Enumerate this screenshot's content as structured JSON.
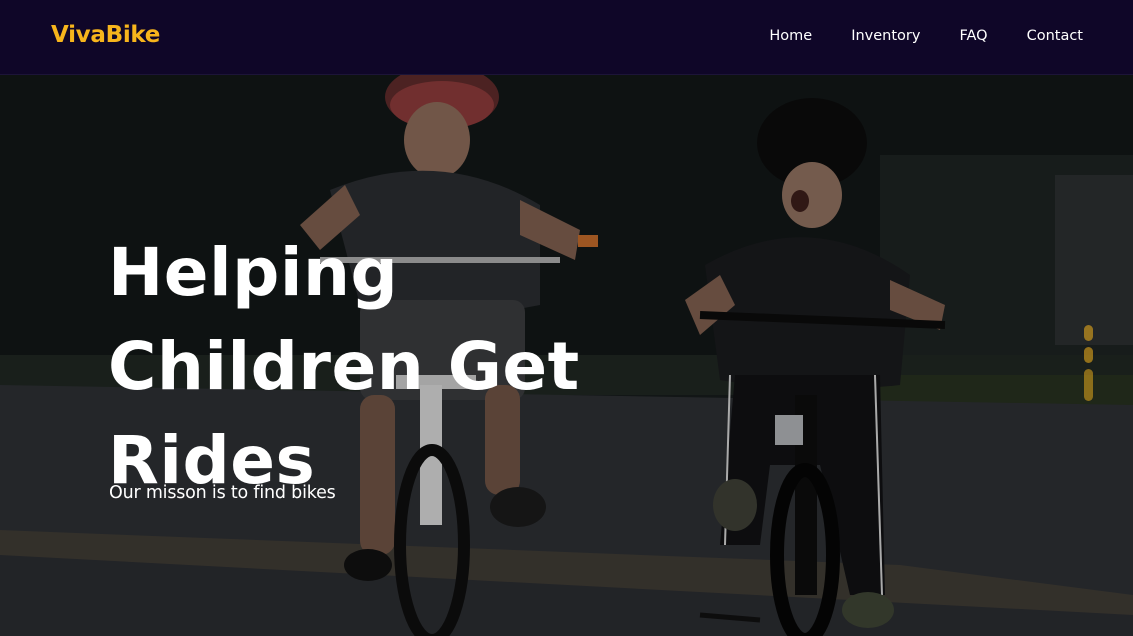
{
  "navbar": {
    "brand": "VivaBike",
    "links": [
      "Home",
      "Inventory",
      "FAQ",
      "Contact"
    ]
  },
  "hero": {
    "title_lines": [
      "Helping",
      "Children Get",
      "Rides"
    ],
    "subtitle": "Our misson is to find bikes",
    "slide_count": 3,
    "active_slide": 3
  },
  "colors": {
    "brand": "#f7b51c",
    "nav_bg": "#0f0628",
    "text": "#ffffff"
  }
}
